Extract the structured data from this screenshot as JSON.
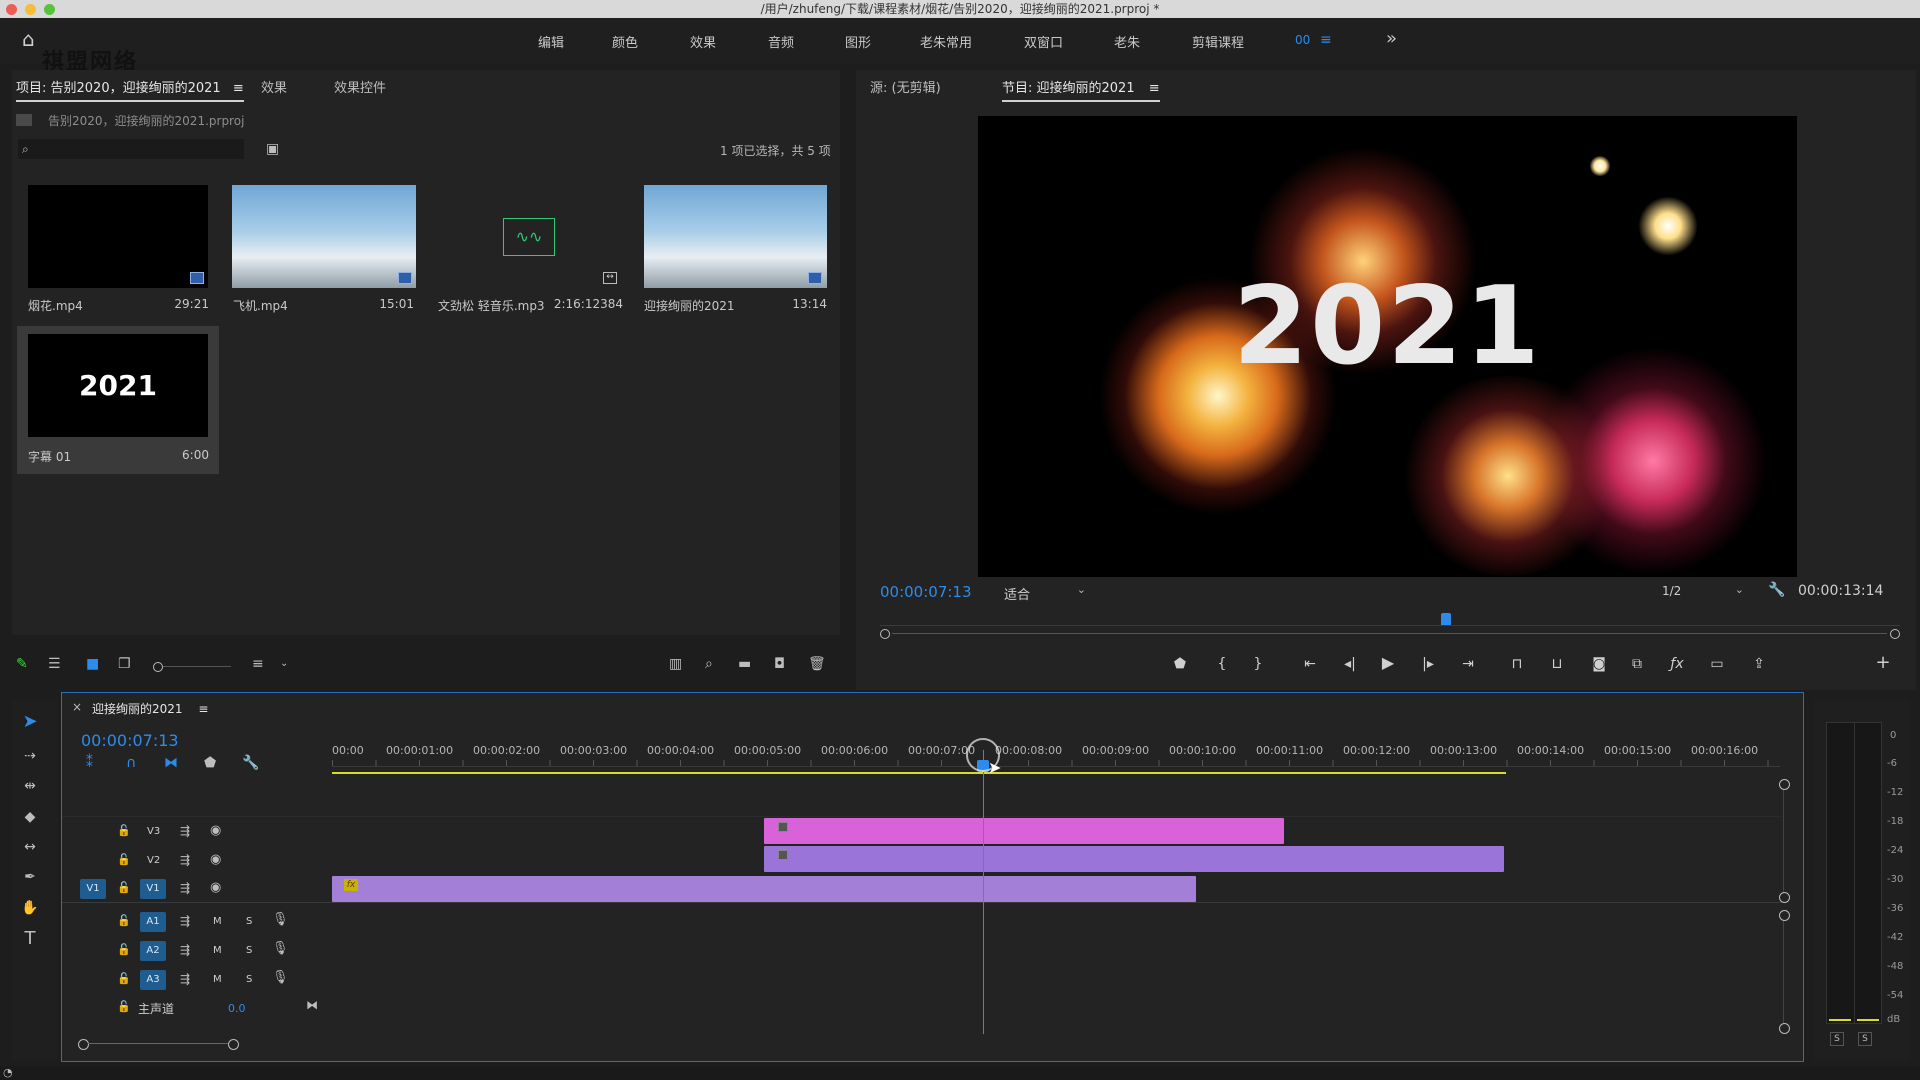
{
  "window": {
    "title": "/用户/zhufeng/下载/课程素材/烟花/告别2020，迎接绚丽的2021.prproj *",
    "watermark": "祺盟网络"
  },
  "workspaces": {
    "items": [
      "编辑",
      "颜色",
      "效果",
      "音频",
      "图形",
      "老朱常用",
      "双窗口",
      "老朱",
      "剪辑课程",
      "00"
    ],
    "more": "»"
  },
  "project_panel": {
    "tabs": [
      "项目: 告别2020，迎接绚丽的2021",
      "效果",
      "效果控件"
    ],
    "file": "告别2020，迎接绚丽的2021.prproj",
    "search_placeholder": "",
    "selection_status": "1 项已选择，共 5 项",
    "items": [
      {
        "name": "烟花.mp4",
        "duration": "29:21"
      },
      {
        "name": "飞机.mp4",
        "duration": "15:01"
      },
      {
        "name": "文劲松 轻音乐.mp3",
        "duration": "2:16:12384"
      },
      {
        "name": "迎接绚丽的2021",
        "duration": "13:14"
      },
      {
        "name": "字幕 01",
        "duration": "6:00",
        "thumb_text": "2021"
      }
    ]
  },
  "monitor_panel": {
    "source_tab": "源: (无剪辑)",
    "program_tab": "节目: 迎接绚丽的2021",
    "video_text": "2021",
    "current_time": "00:00:07:13",
    "fit": "适合",
    "resolution": "1/2",
    "duration": "00:00:13:14",
    "playhead_fraction": 0.555
  },
  "timeline": {
    "sequence_name": "迎接绚丽的2021",
    "close": "×",
    "current_time": "00:00:07:13",
    "ruler": [
      "00:00",
      "00:00:01:00",
      "00:00:02:00",
      "00:00:03:00",
      "00:00:04:00",
      "00:00:05:00",
      "00:00:06:00",
      "00:00:07:00",
      "00:00:08:00",
      "00:00:09:00",
      "00:00:10:00",
      "00:00:11:00",
      "00:00:12:00",
      "00:00:13:00",
      "00:00:14:00",
      "00:00:15:00",
      "00:00:16:00"
    ],
    "video_tracks": [
      "V3",
      "V2",
      "V1"
    ],
    "source_patch": "V1",
    "audio_tracks": [
      "A1",
      "A2",
      "A3"
    ],
    "mute": "M",
    "solo": "S",
    "master_label": "主声道",
    "master_value": "0.0",
    "clip_fx": "fx"
  },
  "audio_meter": {
    "scale": [
      "0",
      "-6",
      "-12",
      "-18",
      "-24",
      "-30",
      "-36",
      "-42",
      "-48",
      "-54",
      "dB"
    ],
    "solo_buttons": [
      "S",
      "S"
    ]
  },
  "colors": {
    "accent_blue": "#2d8ceb",
    "clip_v3": "#d862d8",
    "clip_v2": "#9a74d8",
    "clip_v1": "#a47fd8",
    "work_area": "#d9d92a"
  }
}
